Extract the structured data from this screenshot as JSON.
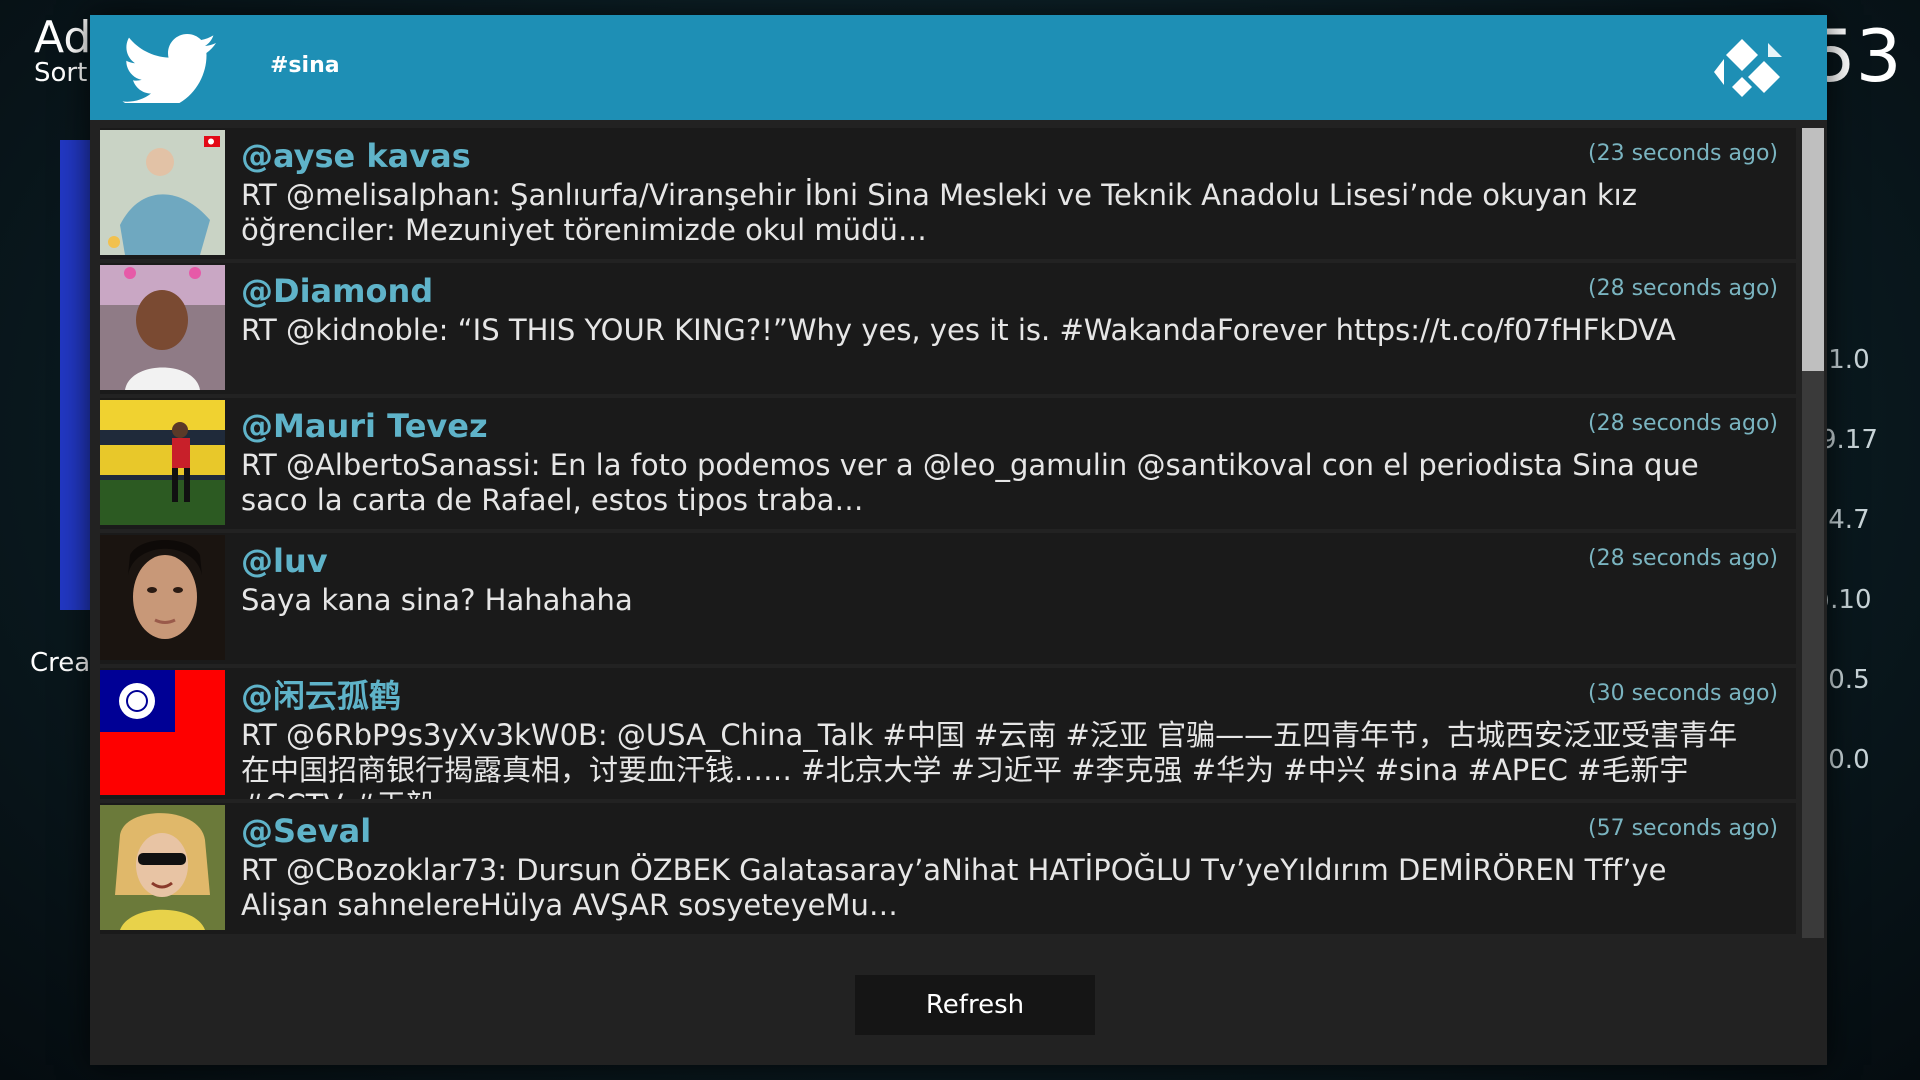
{
  "background": {
    "title": "Ad",
    "sort": "Sort",
    "create": "Crea",
    "clock": "53",
    "values": [
      ".1.0",
      "9.17",
      ".4.7",
      ").10",
      ".0.5",
      ".0.0"
    ]
  },
  "dialog": {
    "header": {
      "hashtag": "#sina",
      "twitter_icon": "twitter-bird-icon",
      "kodi_icon": "kodi-logo-icon",
      "color": "#1e8fb5"
    },
    "tweets": [
      {
        "handle": "@ayse kavas",
        "time": "(23 seconds ago)",
        "text": "RT @melisalphan: Şanlıurfa/Viranşehir İbni Sina Mesleki ve Teknik Anadolu Lisesi’nde okuyan kız öğrenciler: Mezuniyet törenimizde okul müdü…"
      },
      {
        "handle": "@Diamond",
        "time": "(28 seconds ago)",
        "text": "RT @kidnoble: “IS THIS YOUR KING?!”Why yes, yes it is. #WakandaForever https://t.co/f07fHFkDVA"
      },
      {
        "handle": "@Mauri Tevez",
        "time": "(28 seconds ago)",
        "text": "RT @AlbertoSanassi: En la foto podemos ver a @leo_gamulin @santikoval con el periodista Sina que saco la carta de Rafael, estos tipos traba…"
      },
      {
        "handle": "@luv",
        "time": "(28 seconds ago)",
        "text": "Saya kana sina? Hahahaha"
      },
      {
        "handle": "@闲云孤鹤",
        "time": "(30 seconds ago)",
        "text": "RT @6RbP9s3yXv3kW0B: @USA_China_Talk #中国 #云南 #泛亚 官骗——五四青年节，古城西安泛亚受害青年在中国招商银行揭露真相，讨要血汗钱…… #北京大学 #习近平 #李克强 #华为 #中兴 #sina #APEC #毛新宇 #CCTV #王毅…"
      },
      {
        "handle": "@Seval",
        "time": "(57 seconds ago)",
        "text": "RT @CBozoklar73: Dursun ÖZBEK Galatasaray’aNihat HATİPOĞLU Tv’yeYıldırım DEMİRÖREN Tff’ye Alişan sahnelereHülya AVŞAR sosyeteyeMu…"
      }
    ],
    "refresh_label": "Refresh",
    "scroll_fraction": 0.3
  }
}
